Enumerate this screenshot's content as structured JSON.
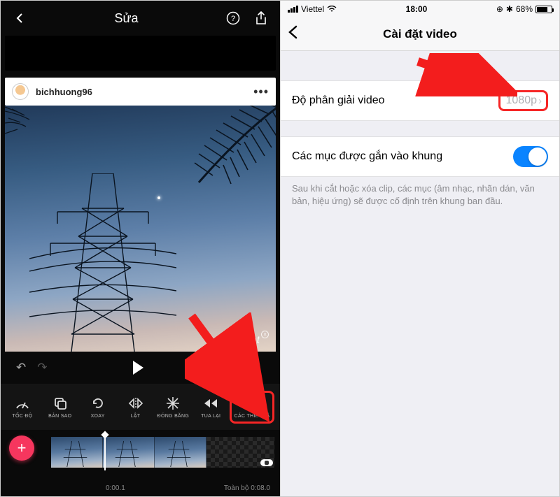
{
  "left": {
    "title": "Sửa",
    "username": "bichhuong96",
    "watermark": "InShot",
    "toolbar": [
      {
        "icon": "speed-icon",
        "label": "TỐC ĐỘ"
      },
      {
        "icon": "copy-icon",
        "label": "BẢN SAO"
      },
      {
        "icon": "rotate-icon",
        "label": "XOAY"
      },
      {
        "icon": "flip-icon",
        "label": "LẬT"
      },
      {
        "icon": "freeze-icon",
        "label": "ĐÓNG BĂNG"
      },
      {
        "icon": "rewind-icon",
        "label": "TUA LẠI"
      },
      {
        "icon": "settings-icon",
        "label": "CÁC THIẾT LẬ"
      }
    ],
    "timeline": {
      "start": "0:00.1",
      "end": "Toàn bộ 0:08.0"
    }
  },
  "right": {
    "status": {
      "carrier": "Viettel",
      "time": "18:00",
      "battery": "68%"
    },
    "title": "Cài đặt video",
    "rows": {
      "resolution": {
        "label": "Độ phân giải video",
        "value": "1080p"
      },
      "snap": {
        "label": "Các mục được gắn vào khung",
        "on": true
      }
    },
    "caption": "Sau khi cắt hoặc xóa clip, các mục (âm nhạc, nhãn dán, văn bản, hiệu ứng) sẽ được cố định trên khung ban đầu."
  }
}
